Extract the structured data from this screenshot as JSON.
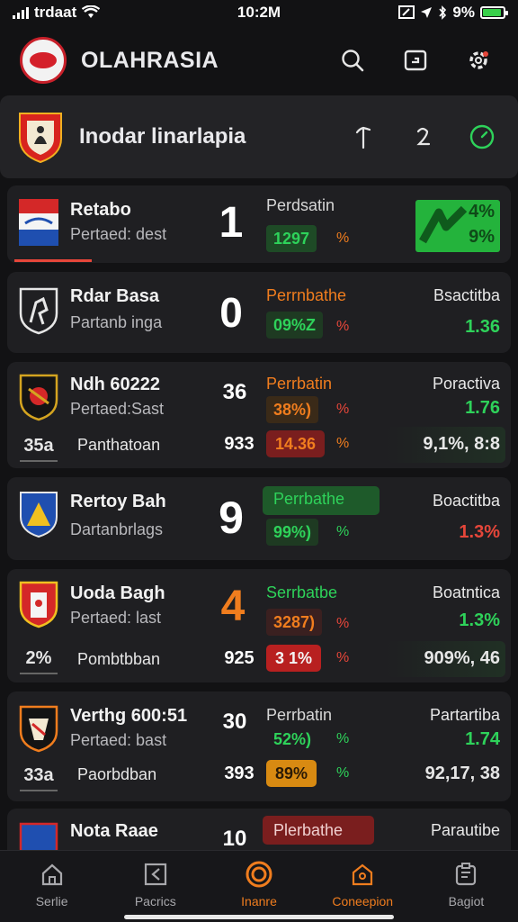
{
  "status_bar": {
    "carrier": "trdaat",
    "time": "10:2M",
    "battery": "9%",
    "battery_level": 0.9
  },
  "header": {
    "title": "OLAHRASIA"
  },
  "league": {
    "title": "Inodar linarlapia"
  },
  "matches": [
    {
      "team": "Retabo",
      "sub": "Pertaed: dest",
      "score": "1",
      "stat_label": "Perdsatin",
      "stat_value": "1297",
      "stat_pct": "%",
      "right_badge": "4%",
      "right_badge2": "9%"
    },
    {
      "team": "Rdar Basa",
      "sub": "Partanb inga",
      "score": "0",
      "stat_label": "Perrnbathe",
      "stat_value": "09%Z",
      "stat_pct": "%",
      "right_label": "Bsactitba",
      "right_value": "1.36"
    },
    {
      "team": "Ndh 60222",
      "sub": "Pertaed:Sast",
      "score": "36",
      "stat_label": "Perrbatin",
      "stat_value": "38%)",
      "stat_pct": "%",
      "right_label": "Poractiva",
      "right_value": "1.76",
      "extra_left": "35a",
      "extra_label": "Panthatoan",
      "extra_score": "933",
      "extra_pill": "14.36",
      "extra_pct": "%",
      "extra_right": "9,1%, 8:8"
    },
    {
      "team": "Rertoy Bah",
      "sub": "Dartanbrlags",
      "score": "9",
      "stat_label": "Perrbathe",
      "stat_value": "99%)",
      "stat_pct": "%",
      "right_label": "Boactitba",
      "right_value": "1.3%"
    },
    {
      "team": "Uoda Bagh",
      "sub": "Pertaed: last",
      "score": "4",
      "stat_label": "Serrbatbe",
      "stat_value": "3287)",
      "stat_pct": "%",
      "right_label": "Boatntica",
      "right_value": "1.3%",
      "extra_left": "2%",
      "extra_label": "Pombtbban",
      "extra_score": "925",
      "extra_pill": "3 1%",
      "extra_pct": "%",
      "extra_right": "909%, 46"
    },
    {
      "team": "Verthg 600:51",
      "sub": "Pertaed: bast",
      "score": "30",
      "stat_label": "Perrbatin",
      "stat_value": "52%)",
      "stat_pct": "%",
      "right_label": "Partartiba",
      "right_value": "1.74",
      "extra_left": "33a",
      "extra_label": "Paorbdban",
      "extra_score": "393",
      "extra_pill": "89%",
      "extra_pct": "%",
      "extra_right": "92,17, 38"
    },
    {
      "team": "Nota Raae",
      "score": "10",
      "stat_label": "Plerbathe",
      "right_label": "Parautibe"
    }
  ],
  "nav": [
    {
      "label": "Serlie",
      "icon": "home-icon"
    },
    {
      "label": "Pacrics",
      "icon": "practice-icon"
    },
    {
      "label": "Inanre",
      "icon": "target-icon"
    },
    {
      "label": "Coneepion",
      "icon": "competition-icon"
    },
    {
      "label": "Bagiot",
      "icon": "report-icon"
    }
  ],
  "colors": {
    "background": "#121214",
    "card": "#1f1f22",
    "green": "#2ed25a",
    "red": "#e6463a",
    "orange": "#f07d1e",
    "accent": "#f07d1e"
  }
}
